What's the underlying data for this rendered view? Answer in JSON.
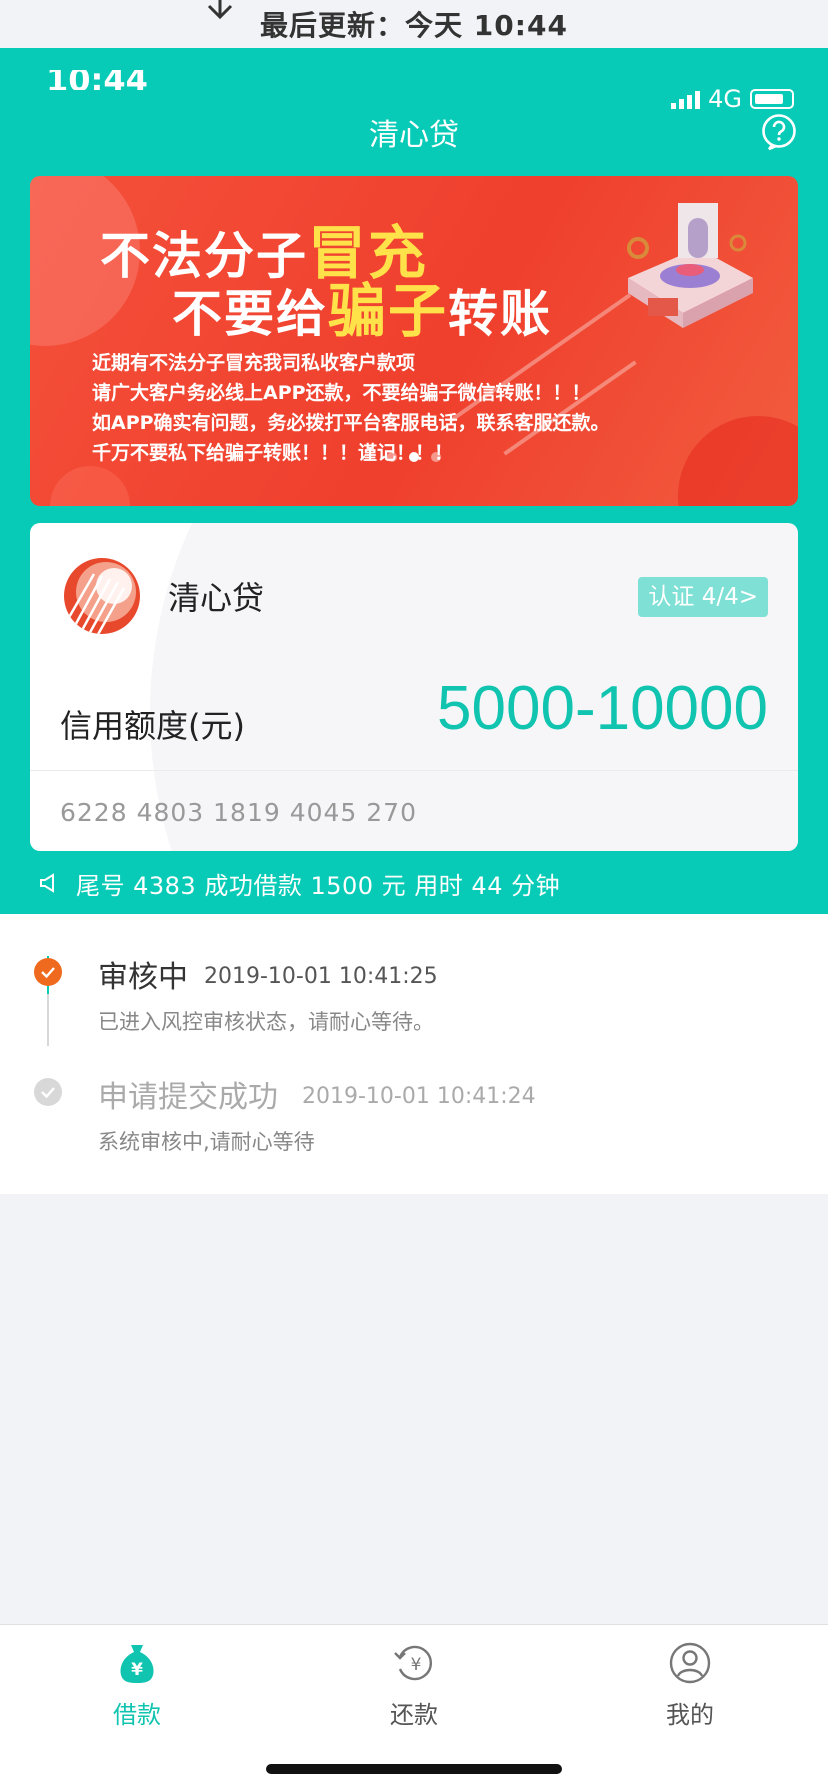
{
  "refresh": {
    "text": "最后更新：今天 10:44"
  },
  "status_bar": {
    "time": "10:44",
    "network": "4G"
  },
  "nav": {
    "title": "清心贷"
  },
  "banner": {
    "headline_line1_a": "不法分子",
    "headline_line1_b": "冒充",
    "headline_line2_a": "不要给",
    "headline_line2_b": "骗子",
    "headline_line2_c": "转账",
    "lines": [
      "近期有不法分子冒充我司私收客户款项",
      "请广大客户务必线上APP还款，不要给骗子微信转账！！！",
      "如APP确实有问题，务必拨打平台客服电话，联系客服还款。",
      "千万不要私下给骗子转账！！！谨记！！！"
    ]
  },
  "card": {
    "name": "清心贷",
    "auth_badge": "认证 4/4>",
    "credit_label": "信用额度(元)",
    "credit_value": "5000-10000",
    "card_number": "6228 4803 1819 4045 270"
  },
  "ticker": {
    "text": "尾号 4383 成功借款 1500 元 用时 44 分钟"
  },
  "progress": {
    "steps": [
      {
        "title": "审核中",
        "time": "2019-10-01 10:41:25",
        "desc": "已进入风控审核状态，请耐心等待。"
      },
      {
        "title": "申请提交成功",
        "time": "2019-10-01 10:41:24",
        "desc": "系统审核中,请耐心等待"
      }
    ]
  },
  "tabs": [
    {
      "label": "借款",
      "icon": "money-bag-icon"
    },
    {
      "label": "还款",
      "icon": "repay-icon"
    },
    {
      "label": "我的",
      "icon": "profile-icon"
    }
  ],
  "colors": {
    "teal": "#07cbb6",
    "accent": "#10c4b0",
    "orange": "#ef6a1e",
    "banner_red": "#ef3f2d"
  }
}
